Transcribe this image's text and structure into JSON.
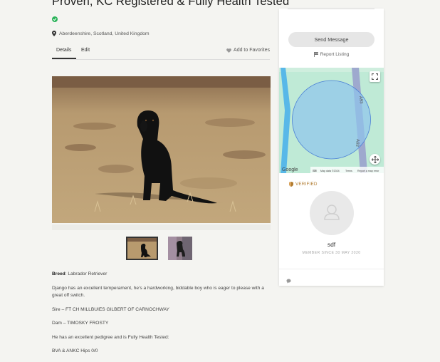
{
  "listing": {
    "title": "Proven, KC Registered & Fully Health Tested",
    "location": "Aberdeenshire, Scotland, United Kingdom"
  },
  "tabs": [
    {
      "label": "Details"
    },
    {
      "label": "Edit"
    }
  ],
  "actions": {
    "favorites": "Add to Favorites"
  },
  "description": {
    "breed_label": "Breed",
    "breed_value": ": Labrador Retriever",
    "paragraphs": [
      "Django has an excellent temperament, he’s a hardworking, biddable boy who is eager to please with a great off switch.",
      "Sire – FT CH MILLBUIES GILBERT OF CARNOCHWAY",
      "Dam – TIMOSKY FROSTY",
      "He has an excellent pedigree and is Fully Health Tested:",
      "BVA & ANKC Hips 0/0"
    ]
  },
  "sidebar": {
    "send_message": "Send Message",
    "report": "Report Listing",
    "verified": "VERIFIED",
    "member_name": "sdf",
    "member_since": "MEMBER SINCE 30 MAY 2020"
  },
  "map": {
    "google": "Google",
    "attribution": "Map data ©2024",
    "terms": "Terms",
    "report_error": "Report a map error",
    "road_label_1": "A93",
    "road_label_2": "A93"
  },
  "colors": {
    "verified_green": "#2bb35a",
    "verified_gold": "#b07a2e",
    "map_circle": "#5b9de8"
  }
}
